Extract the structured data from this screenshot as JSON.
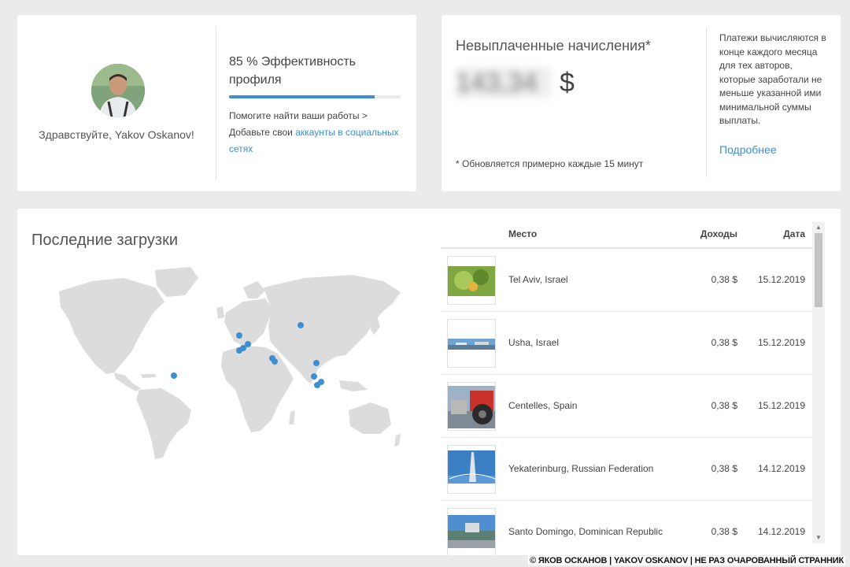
{
  "profile": {
    "greeting": "Здравствуйте, Yakov Oskanov!",
    "efficiency_title": "85 % Эффективность профиля",
    "efficiency_percent": 85,
    "help_line1": "Помогите найти ваши работы >",
    "help_line2_prefix": "Добавьте свои ",
    "help_link": "аккаунты в социальных сетях"
  },
  "earnings": {
    "title": "Невыплаченные начисления*",
    "amount_blurred": "143,34",
    "currency": "$",
    "note": "* Обновляется примерно каждые 15 минут",
    "side_text": "Платежи вычисляются в конце каждого месяца для тех авторов, которые заработали не меньше указанной ими минимальной суммы выплаты.",
    "more_link": "Подробнее"
  },
  "uploads": {
    "title": "Последние загрузки",
    "columns": {
      "place": "Место",
      "earnings": "Доходы",
      "date": "Дата"
    },
    "rows": [
      {
        "place": "Tel Aviv, Israel",
        "earnings": "0,38 $",
        "date": "15.12.2019",
        "thumb": "leaves-photo"
      },
      {
        "place": "Usha, Israel",
        "earnings": "0,38 $",
        "date": "15.12.2019",
        "thumb": "panorama-photo"
      },
      {
        "place": "Centelles, Spain",
        "earnings": "0,38 $",
        "date": "15.12.2019",
        "thumb": "tractor-photo"
      },
      {
        "place": "Yekaterinburg, Russian Federation",
        "earnings": "0,38 $",
        "date": "14.12.2019",
        "thumb": "tower-photo"
      },
      {
        "place": "Santo Domingo, Dominican Republic",
        "earnings": "0,38 $",
        "date": "14.12.2019",
        "thumb": "city-photo"
      }
    ]
  },
  "colors": {
    "accent": "#3d8fd1",
    "map_land": "#dcdcdc",
    "map_dot": "#3d8fd1"
  },
  "watermark": "© ЯКОВ ОСКАНОВ | YAKOV OSKANOV | НЕ РАЗ ОЧАРОВАННЫЙ СТРАННИК"
}
